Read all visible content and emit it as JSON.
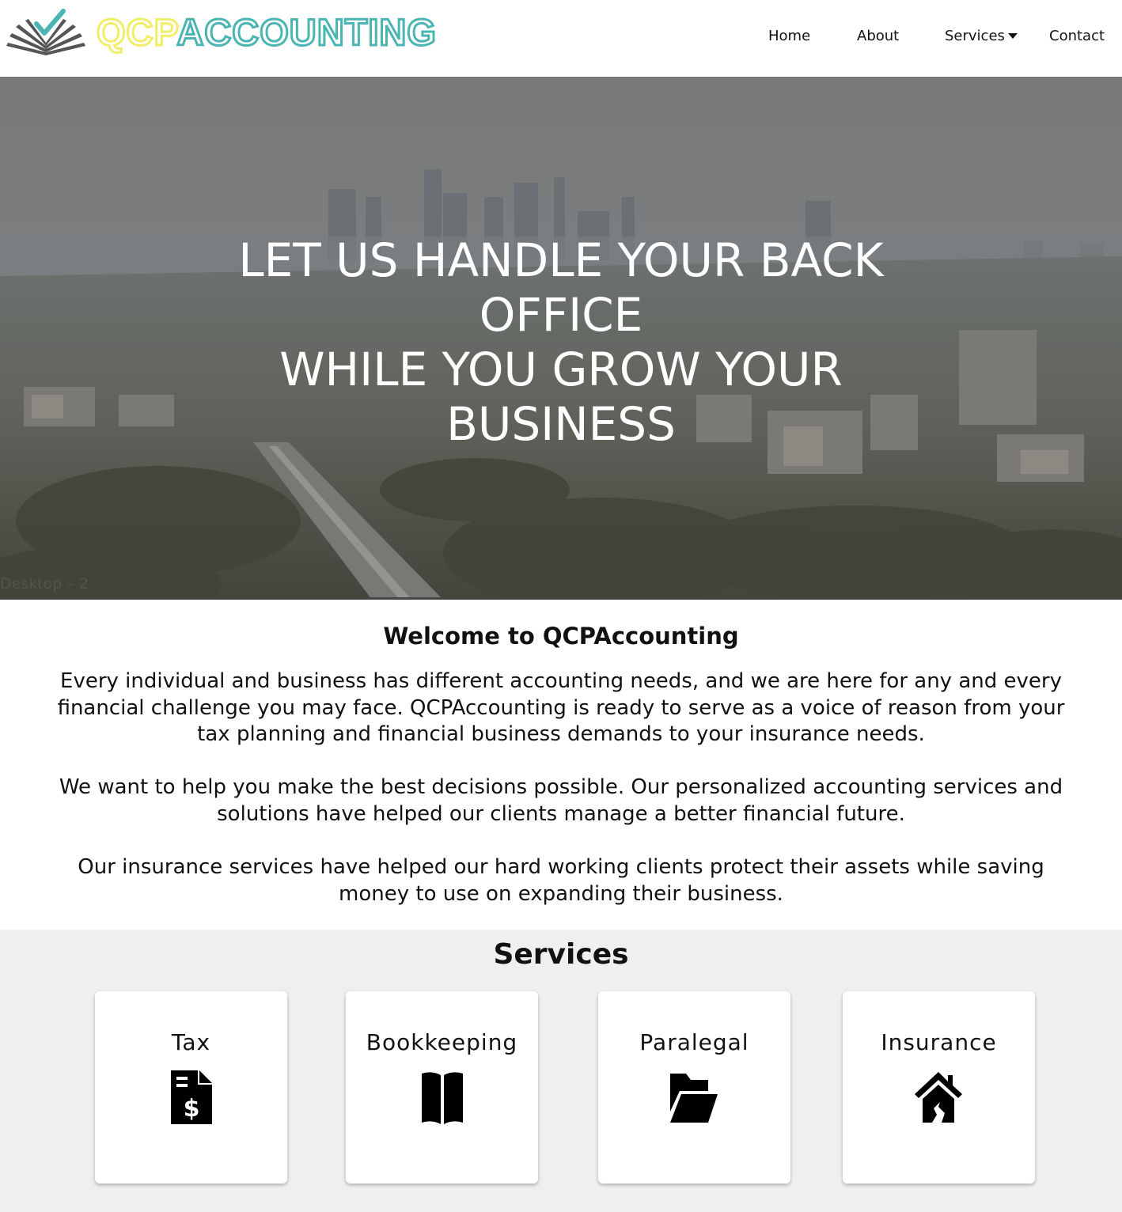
{
  "brand": {
    "part1": "QCP",
    "part2": "ACCOUNTING",
    "color_part1": "#f2ed6a",
    "color_part2": "#4ab5b2",
    "logo_icon": "open-book-checkmark-icon"
  },
  "nav": {
    "items": [
      {
        "label": "Home"
      },
      {
        "label": "About"
      },
      {
        "label": "Services",
        "has_dropdown": true
      },
      {
        "label": "Contact"
      }
    ]
  },
  "hero": {
    "title_lines": [
      "LET US HANDLE YOUR BACK",
      "OFFICE",
      "WHILE YOU GROW YOUR",
      "BUSINESS"
    ],
    "artboard_label": "Desktop – 2"
  },
  "welcome": {
    "title": "Welcome to QCPAccounting",
    "paragraphs": [
      "Every individual and business has different accounting needs, and we are here for any and every financial challenge you may face. QCPAccounting is ready to serve as a voice of reason from your tax planning and financial business demands to your insurance needs.",
      "We want to help you make the best decisions possible. Our personalized accounting services and solutions have helped our clients manage a better financial future.",
      "Our insurance services have helped our hard working clients protect their assets while saving money to use on expanding their business."
    ]
  },
  "services": {
    "title": "Services",
    "cards": [
      {
        "label": "Tax",
        "icon": "file-invoice-dollar-icon"
      },
      {
        "label": "Bookkeeping",
        "icon": "book-icon"
      },
      {
        "label": "Paralegal",
        "icon": "folder-open-icon"
      },
      {
        "label": "Insurance",
        "icon": "house-damage-icon"
      }
    ]
  }
}
